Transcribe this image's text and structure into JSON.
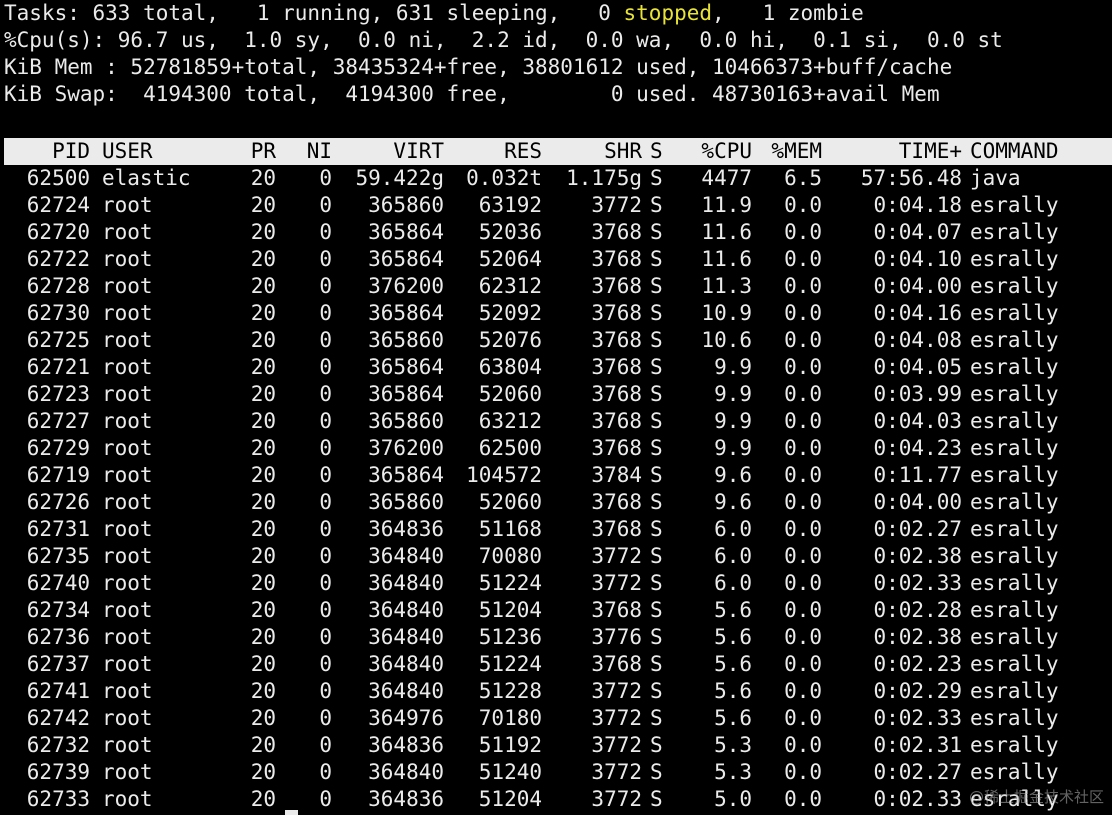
{
  "summary": {
    "tasks_prefix": "Tasks: 633 total,   1 running, 631 sleeping,   0 ",
    "tasks_stopped": "stopped",
    "tasks_suffix": ",   1 zombie",
    "cpu": "%Cpu(s): 96.7 us,  1.0 sy,  0.0 ni,  2.2 id,  0.0 wa,  0.0 hi,  0.1 si,  0.0 st",
    "mem": "KiB Mem : 52781859+total, 38435324+free, 38801612 used, 10466373+buff/cache",
    "swap": "KiB Swap:  4194300 total,  4194300 free,        0 used. 48730163+avail Mem"
  },
  "colors": {
    "background": "#000000",
    "foreground": "#ebebeb",
    "stopped": "#e8e437"
  },
  "columns": {
    "pid": "PID",
    "user": "USER",
    "pr": "PR",
    "ni": "NI",
    "virt": "VIRT",
    "res": "RES",
    "shr": "SHR",
    "s": "S",
    "cpu": "%CPU",
    "mem": "%MEM",
    "time": "TIME+",
    "command": "COMMAND"
  },
  "processes": [
    {
      "pid": "62500",
      "user": "elastic",
      "pr": "20",
      "ni": "0",
      "virt": "59.422g",
      "res": "0.032t",
      "shr": "1.175g",
      "s": "S",
      "cpu": "4477",
      "mem": "6.5",
      "time": "57:56.48",
      "command": "java"
    },
    {
      "pid": "62724",
      "user": "root",
      "pr": "20",
      "ni": "0",
      "virt": "365860",
      "res": "63192",
      "shr": "3772",
      "s": "S",
      "cpu": "11.9",
      "mem": "0.0",
      "time": "0:04.18",
      "command": "esrally"
    },
    {
      "pid": "62720",
      "user": "root",
      "pr": "20",
      "ni": "0",
      "virt": "365864",
      "res": "52036",
      "shr": "3768",
      "s": "S",
      "cpu": "11.6",
      "mem": "0.0",
      "time": "0:04.07",
      "command": "esrally"
    },
    {
      "pid": "62722",
      "user": "root",
      "pr": "20",
      "ni": "0",
      "virt": "365864",
      "res": "52064",
      "shr": "3768",
      "s": "S",
      "cpu": "11.6",
      "mem": "0.0",
      "time": "0:04.10",
      "command": "esrally"
    },
    {
      "pid": "62728",
      "user": "root",
      "pr": "20",
      "ni": "0",
      "virt": "376200",
      "res": "62312",
      "shr": "3768",
      "s": "S",
      "cpu": "11.3",
      "mem": "0.0",
      "time": "0:04.00",
      "command": "esrally"
    },
    {
      "pid": "62730",
      "user": "root",
      "pr": "20",
      "ni": "0",
      "virt": "365864",
      "res": "52092",
      "shr": "3768",
      "s": "S",
      "cpu": "10.9",
      "mem": "0.0",
      "time": "0:04.16",
      "command": "esrally"
    },
    {
      "pid": "62725",
      "user": "root",
      "pr": "20",
      "ni": "0",
      "virt": "365860",
      "res": "52076",
      "shr": "3768",
      "s": "S",
      "cpu": "10.6",
      "mem": "0.0",
      "time": "0:04.08",
      "command": "esrally"
    },
    {
      "pid": "62721",
      "user": "root",
      "pr": "20",
      "ni": "0",
      "virt": "365864",
      "res": "63804",
      "shr": "3768",
      "s": "S",
      "cpu": "9.9",
      "mem": "0.0",
      "time": "0:04.05",
      "command": "esrally"
    },
    {
      "pid": "62723",
      "user": "root",
      "pr": "20",
      "ni": "0",
      "virt": "365864",
      "res": "52060",
      "shr": "3768",
      "s": "S",
      "cpu": "9.9",
      "mem": "0.0",
      "time": "0:03.99",
      "command": "esrally"
    },
    {
      "pid": "62727",
      "user": "root",
      "pr": "20",
      "ni": "0",
      "virt": "365860",
      "res": "63212",
      "shr": "3768",
      "s": "S",
      "cpu": "9.9",
      "mem": "0.0",
      "time": "0:04.03",
      "command": "esrally"
    },
    {
      "pid": "62729",
      "user": "root",
      "pr": "20",
      "ni": "0",
      "virt": "376200",
      "res": "62500",
      "shr": "3768",
      "s": "S",
      "cpu": "9.9",
      "mem": "0.0",
      "time": "0:04.23",
      "command": "esrally"
    },
    {
      "pid": "62719",
      "user": "root",
      "pr": "20",
      "ni": "0",
      "virt": "365864",
      "res": "104572",
      "shr": "3784",
      "s": "S",
      "cpu": "9.6",
      "mem": "0.0",
      "time": "0:11.77",
      "command": "esrally"
    },
    {
      "pid": "62726",
      "user": "root",
      "pr": "20",
      "ni": "0",
      "virt": "365860",
      "res": "52060",
      "shr": "3768",
      "s": "S",
      "cpu": "9.6",
      "mem": "0.0",
      "time": "0:04.00",
      "command": "esrally"
    },
    {
      "pid": "62731",
      "user": "root",
      "pr": "20",
      "ni": "0",
      "virt": "364836",
      "res": "51168",
      "shr": "3768",
      "s": "S",
      "cpu": "6.0",
      "mem": "0.0",
      "time": "0:02.27",
      "command": "esrally"
    },
    {
      "pid": "62735",
      "user": "root",
      "pr": "20",
      "ni": "0",
      "virt": "364840",
      "res": "70080",
      "shr": "3772",
      "s": "S",
      "cpu": "6.0",
      "mem": "0.0",
      "time": "0:02.38",
      "command": "esrally"
    },
    {
      "pid": "62740",
      "user": "root",
      "pr": "20",
      "ni": "0",
      "virt": "364840",
      "res": "51224",
      "shr": "3772",
      "s": "S",
      "cpu": "6.0",
      "mem": "0.0",
      "time": "0:02.33",
      "command": "esrally"
    },
    {
      "pid": "62734",
      "user": "root",
      "pr": "20",
      "ni": "0",
      "virt": "364840",
      "res": "51204",
      "shr": "3768",
      "s": "S",
      "cpu": "5.6",
      "mem": "0.0",
      "time": "0:02.28",
      "command": "esrally"
    },
    {
      "pid": "62736",
      "user": "root",
      "pr": "20",
      "ni": "0",
      "virt": "364840",
      "res": "51236",
      "shr": "3776",
      "s": "S",
      "cpu": "5.6",
      "mem": "0.0",
      "time": "0:02.38",
      "command": "esrally"
    },
    {
      "pid": "62737",
      "user": "root",
      "pr": "20",
      "ni": "0",
      "virt": "364840",
      "res": "51224",
      "shr": "3768",
      "s": "S",
      "cpu": "5.6",
      "mem": "0.0",
      "time": "0:02.23",
      "command": "esrally"
    },
    {
      "pid": "62741",
      "user": "root",
      "pr": "20",
      "ni": "0",
      "virt": "364840",
      "res": "51228",
      "shr": "3772",
      "s": "S",
      "cpu": "5.6",
      "mem": "0.0",
      "time": "0:02.29",
      "command": "esrally"
    },
    {
      "pid": "62742",
      "user": "root",
      "pr": "20",
      "ni": "0",
      "virt": "364976",
      "res": "70180",
      "shr": "3772",
      "s": "S",
      "cpu": "5.6",
      "mem": "0.0",
      "time": "0:02.33",
      "command": "esrally"
    },
    {
      "pid": "62732",
      "user": "root",
      "pr": "20",
      "ni": "0",
      "virt": "364836",
      "res": "51192",
      "shr": "3772",
      "s": "S",
      "cpu": "5.3",
      "mem": "0.0",
      "time": "0:02.31",
      "command": "esrally"
    },
    {
      "pid": "62739",
      "user": "root",
      "pr": "20",
      "ni": "0",
      "virt": "364840",
      "res": "51240",
      "shr": "3772",
      "s": "S",
      "cpu": "5.3",
      "mem": "0.0",
      "time": "0:02.27",
      "command": "esrally"
    },
    {
      "pid": "62733",
      "user": "root",
      "pr": "20",
      "ni": "0",
      "virt": "364836",
      "res": "51204",
      "shr": "3772",
      "s": "S",
      "cpu": "5.0",
      "mem": "0.0",
      "time": "0:02.33",
      "command": "esrally"
    }
  ],
  "watermark": "@稀土掘金技术社区"
}
